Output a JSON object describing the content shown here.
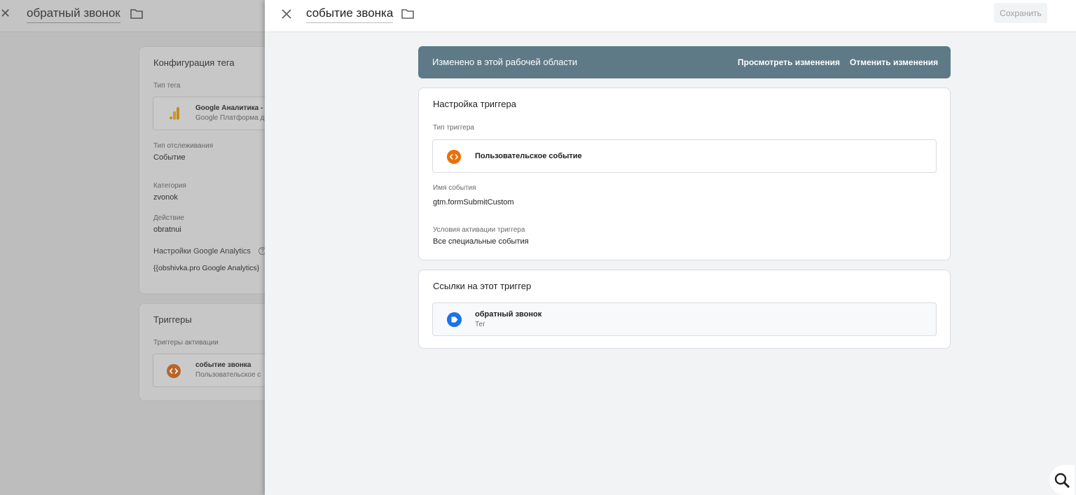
{
  "background": {
    "close_glyph": "✕",
    "title": "обратный звонок",
    "config_card": {
      "title": "Конфигурация тега",
      "tag_type_label": "Тип тега",
      "tag_type_name": "Google Аналитика -",
      "tag_type_sub": "Google Платформа д",
      "tracking_type_label": "Тип отслеживания",
      "tracking_type_value": "Событие",
      "category_label": "Категория",
      "category_value": "zvonok",
      "action_label": "Действие",
      "action_value": "obratnui",
      "ga_settings_label": "Настройки Google Analytics",
      "ga_settings_help": "?",
      "ga_settings_value": "{{obshivka.pro Google Analytics}"
    },
    "triggers_card": {
      "title": "Триггеры",
      "firing_label": "Триггеры активации",
      "trigger_name": "событие звонка",
      "trigger_sub": "Пользовательское с"
    }
  },
  "panel": {
    "close_glyph": "✕",
    "title": "событие звонка",
    "save_label": "Сохранить",
    "banner": {
      "text": "Изменено в этой рабочей области",
      "view_changes": "Просмотреть изменения",
      "discard_changes": "Отменить изменения"
    },
    "trigger_config": {
      "title": "Настройка триггера",
      "type_label": "Тип триггера",
      "type_value": "Пользовательское событие",
      "event_name_label": "Имя события",
      "event_name_value": "gtm.formSubmitCustom",
      "conditions_label": "Условия активации триггера",
      "conditions_value": "Все специальные события"
    },
    "references": {
      "title": "Ссылки на этот триггер",
      "item_name": "обратный звонок",
      "item_type": "Тег"
    }
  },
  "colors": {
    "banner": "#5e7a87",
    "custom_event_icon": "#e8710a",
    "tag_icon": "#1a73e8",
    "analytics_icon": "#f9ab00"
  },
  "icons": {
    "close": "close-icon",
    "folder": "folder-icon",
    "custom_event": "code-brackets-icon",
    "tag": "tag-icon",
    "analytics": "google-analytics-icon",
    "search": "search-icon"
  }
}
